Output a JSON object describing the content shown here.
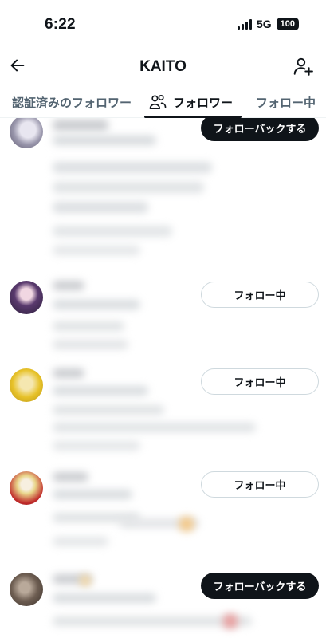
{
  "status_bar": {
    "time": "6:22",
    "network": "5G",
    "battery": "100"
  },
  "header": {
    "title": "KAITO"
  },
  "tabs": [
    {
      "label": "認証済みのフォロワー"
    },
    {
      "label": "フォロワー"
    },
    {
      "label": "フォロー中"
    }
  ],
  "rows": [
    {
      "button_label": "フォローバックする"
    },
    {
      "button_label": "フォロー中"
    },
    {
      "button_label": "フォロー中"
    },
    {
      "button_label": "フォロー中"
    },
    {
      "button_label": "フォローバックする"
    }
  ]
}
